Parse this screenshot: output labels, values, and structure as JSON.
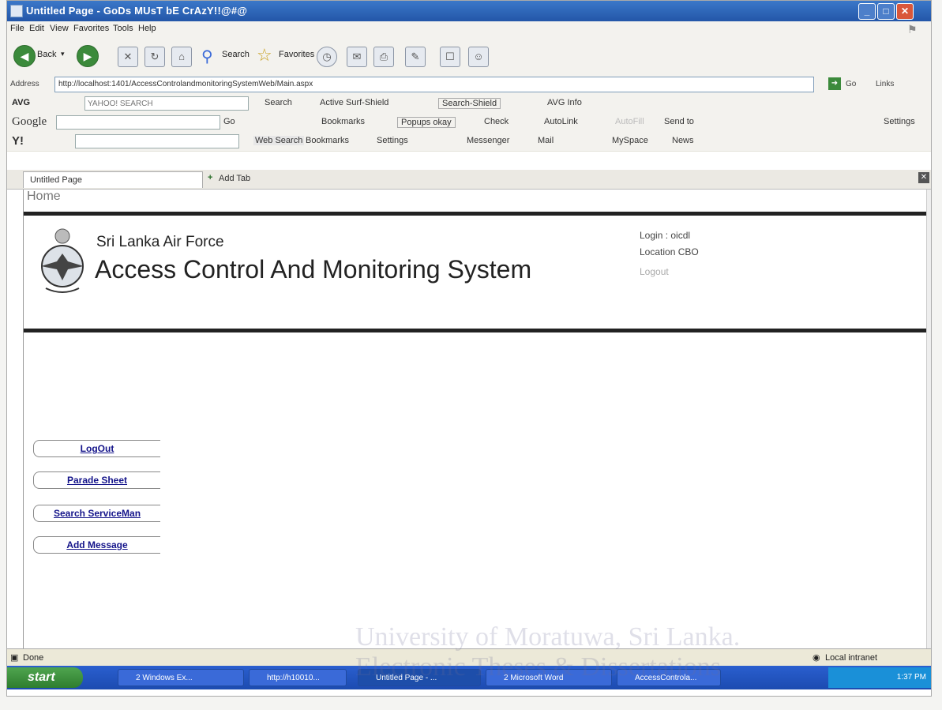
{
  "window": {
    "title": "Untitled Page - GoDs MUsT bE CrAzY!!@#@"
  },
  "menu": [
    "File",
    "Edit",
    "View",
    "Favorites",
    "Tools",
    "Help"
  ],
  "toolbar": {
    "back_label": "Back",
    "search_label": "Search",
    "favorites_label": "Favorites"
  },
  "address": {
    "label": "Address",
    "url": "http://localhost:1401/AccessControlandmonitoringSystemWeb/Main.aspx",
    "go_label": "Go",
    "links_label": "Links"
  },
  "avg_bar": {
    "brand": "AVG",
    "search_placeholder": "YAHOO! SEARCH",
    "search_label": "Search",
    "active_surf": "Active Surf-Shield",
    "search_shield": "Search-Shield",
    "avg_info": "AVG Info"
  },
  "google_bar": {
    "brand": "Google",
    "go": "Go",
    "bookmarks": "Bookmarks",
    "popups": "Popups okay",
    "check": "Check",
    "autolink": "AutoLink",
    "autofill": "AutoFill",
    "sendto": "Send to",
    "settings": "Settings"
  },
  "yahoo_bar": {
    "brand": "Y!",
    "web_search": "Web Search",
    "bookmarks": "Bookmarks",
    "settings": "Settings",
    "messenger": "Messenger",
    "mail": "Mail",
    "myspace": "MySpace",
    "news": "News"
  },
  "tabs": {
    "active": "Untitled Page",
    "add": "Add Tab"
  },
  "page": {
    "home": "Home",
    "org": "Sri Lanka Air Force",
    "system": "Access Control And Monitoring System",
    "login_label": "Login",
    "login_value": ": oicdl",
    "location_label": "Location",
    "location_value": "CBO",
    "logout_link": "Logout"
  },
  "nav": [
    "LogOut",
    "Parade Sheet",
    "Search ServiceMan",
    "Add Message"
  ],
  "status": {
    "text": "Done",
    "zone": "Local intranet"
  },
  "taskbar": {
    "start": "start",
    "items": [
      "2 Windows Ex...",
      "http://h10010...",
      "Untitled Page - ...",
      "2 Microsoft Word",
      "AccessControla..."
    ],
    "time": "1:37 PM"
  },
  "watermark": {
    "line1": "University of Moratuwa, Sri Lanka.",
    "line2": "Electronic Theses & Dissertations"
  }
}
